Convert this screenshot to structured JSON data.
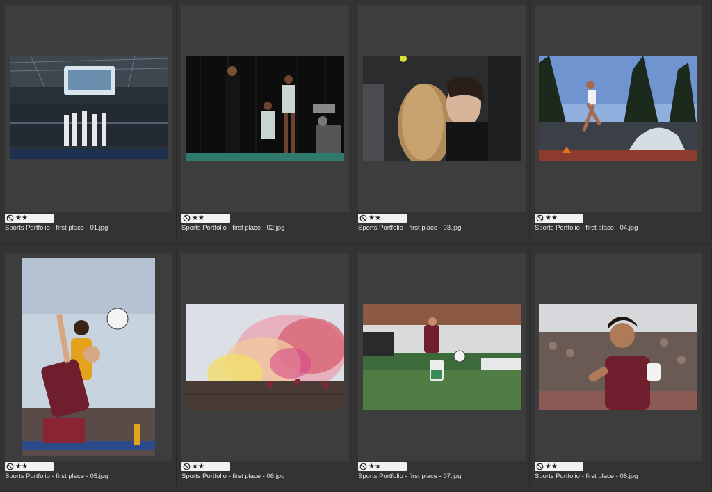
{
  "grid": {
    "items": [
      {
        "filename": "Sports Portfolio - first place - 01.jpg",
        "stars": "★★"
      },
      {
        "filename": "Sports Portfolio - first place - 02.jpg",
        "stars": "★★"
      },
      {
        "filename": "Sports Portfolio - first place - 03.jpg",
        "stars": "★★"
      },
      {
        "filename": "Sports Portfolio - first place - 04.jpg",
        "stars": "★★"
      },
      {
        "filename": "Sports Portfolio - first place - 05.jpg",
        "stars": "★★"
      },
      {
        "filename": "Sports Portfolio - first place - 06.jpg",
        "stars": "★★"
      },
      {
        "filename": "Sports Portfolio - first place - 07.jpg",
        "stars": "★★"
      },
      {
        "filename": "Sports Portfolio - first place - 08.jpg",
        "stars": "★★"
      }
    ]
  },
  "icons": {
    "reject": "reject-flag-icon",
    "star": "star-icon"
  },
  "colors": {
    "background": "#323232",
    "cell": "#3d3d3d",
    "rating_bg": "#f2f2f2",
    "text": "#e6e6e6"
  }
}
